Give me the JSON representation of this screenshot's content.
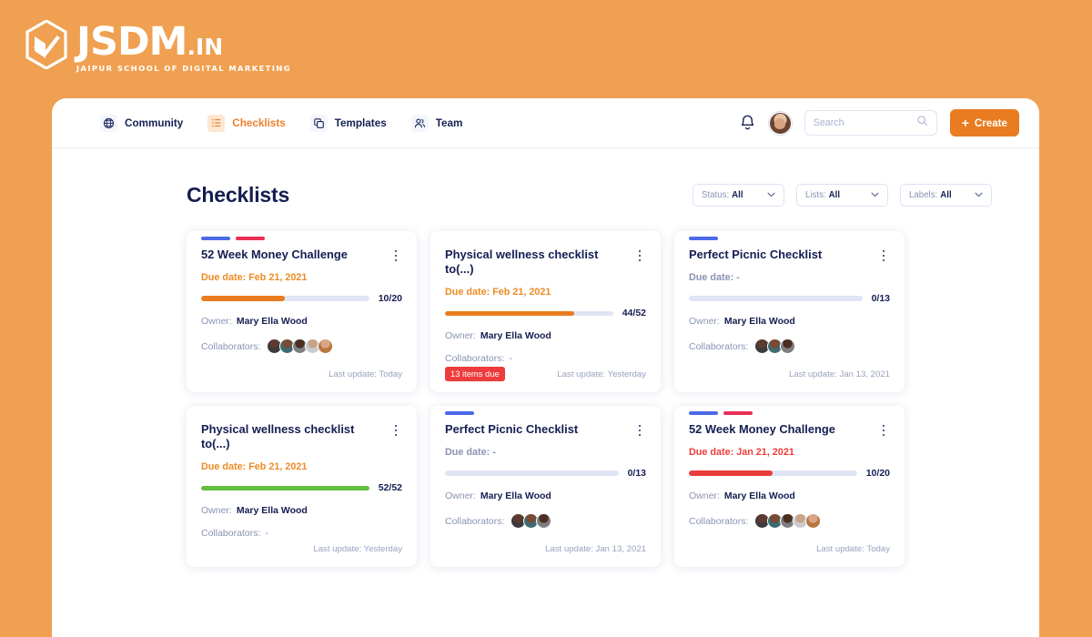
{
  "brand": {
    "name": "JSDM",
    "suffix": ".IN",
    "tagline": "JAIPUR SCHOOL OF DIGITAL MARKETING",
    "bg_color": "#F0A051"
  },
  "nav": {
    "items": [
      {
        "label": "Community",
        "icon": "globe-icon",
        "active": false
      },
      {
        "label": "Checklists",
        "icon": "list-icon",
        "active": true
      },
      {
        "label": "Templates",
        "icon": "copy-icon",
        "active": false
      },
      {
        "label": "Team",
        "icon": "people-icon",
        "active": false
      }
    ],
    "notifications_icon": "bell-icon",
    "profile_icon": "user-avatar",
    "search": {
      "placeholder": "Search",
      "value": "",
      "icon": "search-icon"
    },
    "create_button": {
      "label": "Create",
      "icon": "plus-icon",
      "color": "#E97C20"
    }
  },
  "page": {
    "title": "Checklists",
    "filters": [
      {
        "name": "Status",
        "label": "Status:",
        "value": "All"
      },
      {
        "name": "Lists",
        "label": "Lists:",
        "value": "All"
      },
      {
        "name": "Labels",
        "label": "Labels:",
        "value": "All"
      }
    ]
  },
  "colors": {
    "label_blue": "#4B6AE8",
    "label_red": "#E93055",
    "progress_orange": "#E97C20",
    "progress_green": "#63BE3E",
    "progress_red": "#E93C3C",
    "progress_track": "#DFE5F4",
    "due_orange": "#EE8B23",
    "due_red": "#EE3B3B",
    "due_grey": "#8A93B4",
    "badge_red": "#EE3B3B"
  },
  "labels_text": {
    "due_date": "Due date:",
    "owner": "Owner:",
    "collaborators": "Collaborators:",
    "last_update": "Last update:",
    "none": "-"
  },
  "cards": [
    {
      "title": "52 Week Money Challenge",
      "label_bars": [
        "#4B6AE8",
        "#E93055"
      ],
      "due_date": "Feb 21, 2021",
      "due_state": "orange",
      "progress_done": 10,
      "progress_total": 20,
      "progress_text": "10/20",
      "progress_percent": 50,
      "progress_color": "#E97C20",
      "owner": "Mary Ella Wood",
      "collaborators_count": 5,
      "collaborators_text": "",
      "badge": "",
      "last_update": "Today"
    },
    {
      "title": "Physical wellness checklist to(...)",
      "label_bars": [],
      "due_date": "Feb 21, 2021",
      "due_state": "orange",
      "progress_done": 44,
      "progress_total": 52,
      "progress_text": "44/52",
      "progress_percent": 77,
      "progress_color": "#E97C20",
      "owner": "Mary Ella Wood",
      "collaborators_count": 0,
      "collaborators_text": "-",
      "badge": "13 items due",
      "last_update": "Yesterday"
    },
    {
      "title": "Perfect Picnic Checklist",
      "label_bars": [
        "#4B6AE8"
      ],
      "due_date": "-",
      "due_state": "grey",
      "progress_done": 0,
      "progress_total": 13,
      "progress_text": "0/13",
      "progress_percent": 0,
      "progress_color": "#DFE5F4",
      "owner": "Mary Ella Wood",
      "collaborators_count": 3,
      "collaborators_text": "",
      "badge": "",
      "last_update": "Jan 13, 2021"
    },
    {
      "title": "Physical wellness checklist to(...)",
      "label_bars": [],
      "due_date": "Feb 21, 2021",
      "due_state": "orange",
      "progress_done": 52,
      "progress_total": 52,
      "progress_text": "52/52",
      "progress_percent": 100,
      "progress_color": "#63BE3E",
      "owner": "Mary Ella Wood",
      "collaborators_count": 0,
      "collaborators_text": "-",
      "badge": "",
      "last_update": "Yesterday"
    },
    {
      "title": "Perfect Picnic Checklist",
      "label_bars": [
        "#4B6AE8"
      ],
      "due_date": "-",
      "due_state": "grey",
      "progress_done": 0,
      "progress_total": 13,
      "progress_text": "0/13",
      "progress_percent": 0,
      "progress_color": "#DFE5F4",
      "owner": "Mary Ella Wood",
      "collaborators_count": 3,
      "collaborators_text": "",
      "badge": "",
      "last_update": "Jan 13, 2021"
    },
    {
      "title": "52 Week Money Challenge",
      "label_bars": [
        "#4B6AE8",
        "#E93055"
      ],
      "due_date": "Jan 21, 2021",
      "due_state": "red",
      "progress_done": 10,
      "progress_total": 20,
      "progress_text": "10/20",
      "progress_percent": 50,
      "progress_color": "#E93C3C",
      "owner": "Mary Ella Wood",
      "collaborators_count": 5,
      "collaborators_text": "",
      "badge": "",
      "last_update": "Today"
    }
  ]
}
